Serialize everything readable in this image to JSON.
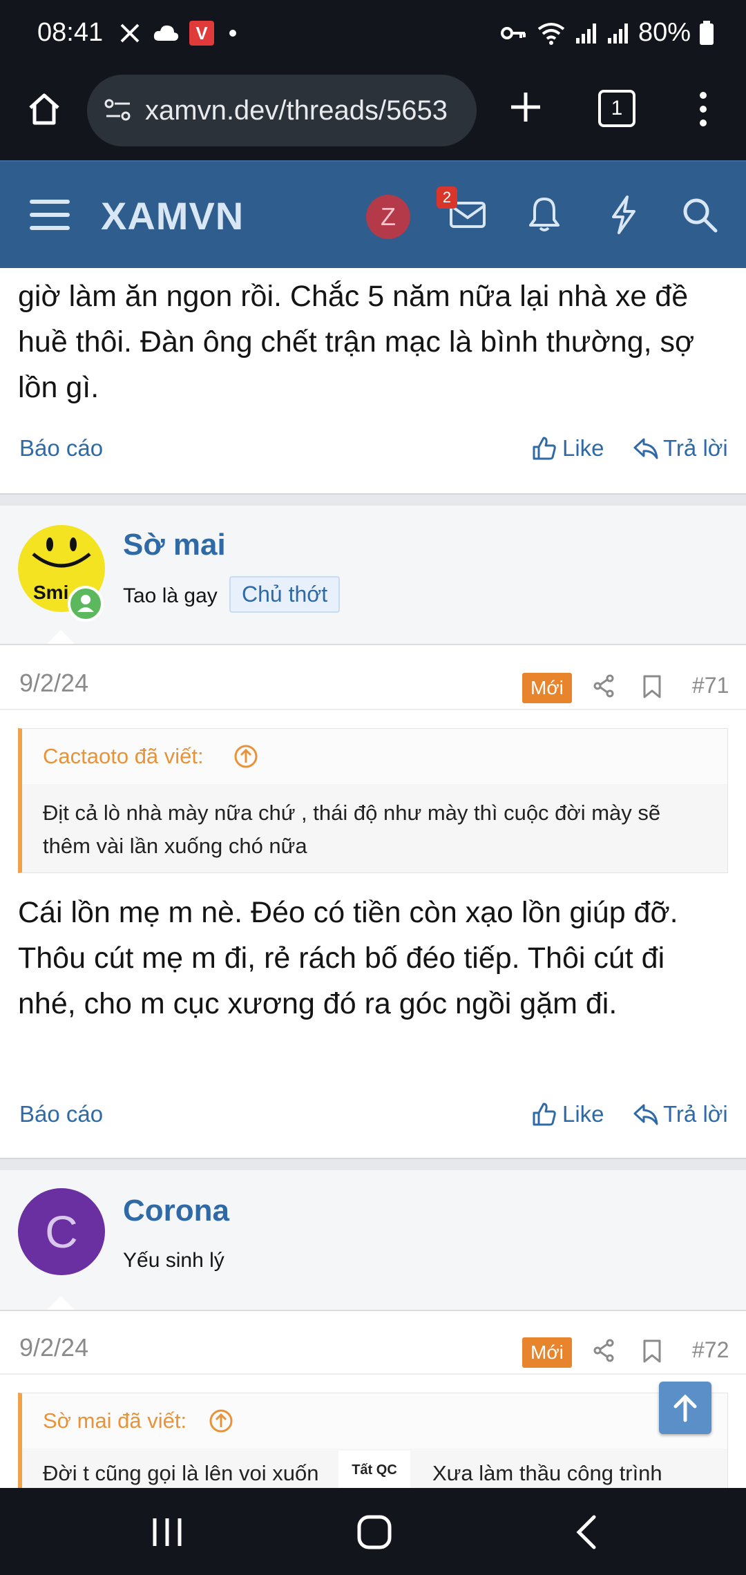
{
  "status": {
    "time": "08:41",
    "battery": "80%"
  },
  "browser": {
    "url": "xamvn.dev/threads/5653",
    "tab_count": "1"
  },
  "site": {
    "logo": "XAMVN",
    "user_initial": "Z",
    "mail_badge": "2"
  },
  "post_top": {
    "text": "giờ làm ăn ngon rồi. Chắc 5 năm nữa lại nhà xe đề huề thôi. Đàn ông chết trận mạc là bình thường, sợ lồn gì.",
    "report": "Báo cáo",
    "like": "Like",
    "reply": "Trả lời"
  },
  "post71": {
    "username": "Sờ mai",
    "user_title": "Tao là gay",
    "role_chip": "Chủ thớt",
    "avatar_text": "Smi",
    "date": "9/2/24",
    "new_label": "Mới",
    "post_number": "#71",
    "quote_author": "Cactaoto đã viết:",
    "quote_text": "Địt cả lò nhà mày nữa chứ , thái độ như mày thì cuộc đời mày sẽ thêm vài lần xuống chó nữa",
    "body": "Cái lồn mẹ m nè. Đéo có tiền còn xạo lồn giúp đỡ. Thôu cút mẹ m đi, rẻ rách bố đéo tiếp. Thôi cút đi nhé, cho m cục xương đó ra góc ngồi gặm đi.",
    "report": "Báo cáo",
    "like": "Like",
    "reply": "Trả lời"
  },
  "post72": {
    "username": "Corona",
    "user_title": "Yếu sinh lý",
    "avatar_letter": "C",
    "date": "9/2/24",
    "new_label": "Mới",
    "post_number": "#72",
    "quote_author": "Sờ mai đã viết:",
    "quote_text_a": "Đời t cũng gọi là lên voi xuốn",
    "quote_text_b": "Xưa làm thầu công trình"
  },
  "ad_label": "Tất QC",
  "colors": {
    "appbar": "#2f5d8e",
    "link": "#2f6aa6",
    "new_badge": "#e8852c",
    "quote_accent": "#f0a24a"
  }
}
